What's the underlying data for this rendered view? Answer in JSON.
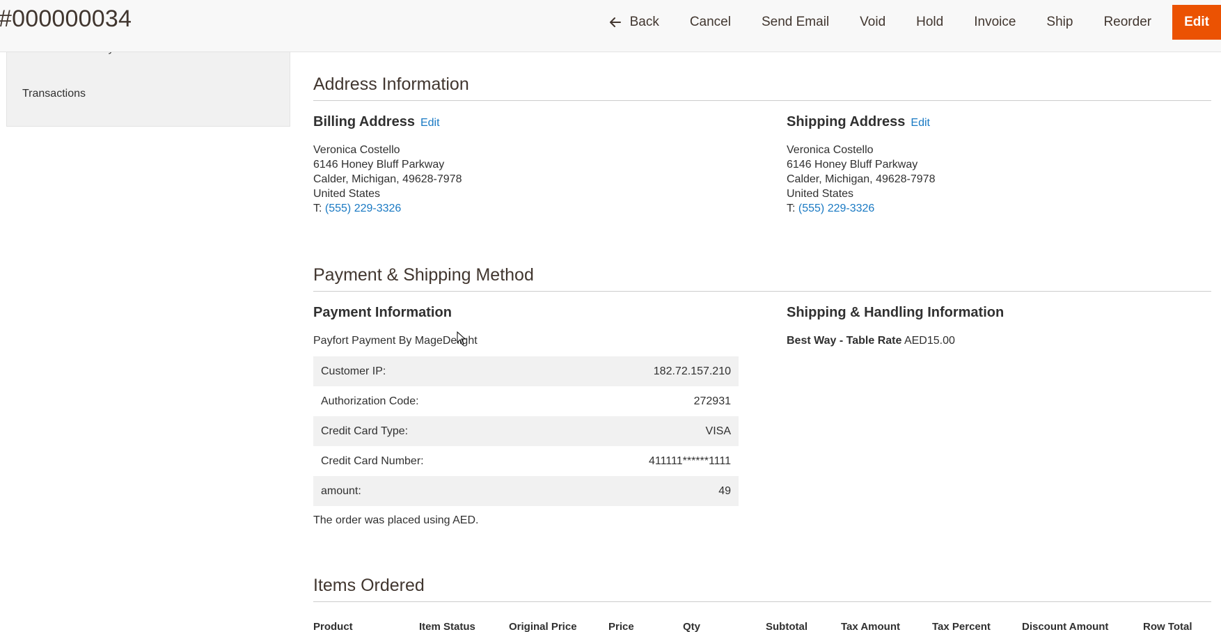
{
  "header": {
    "order_title": "#000000034",
    "actions": {
      "back": "Back",
      "cancel": "Cancel",
      "send_email": "Send Email",
      "void": "Void",
      "hold": "Hold",
      "invoice": "Invoice",
      "ship": "Ship",
      "reorder": "Reorder",
      "edit": "Edit"
    },
    "back_icon": "arrow-left-icon"
  },
  "sidebar": {
    "items": [
      "Comments History",
      "Transactions"
    ]
  },
  "address_information": {
    "title": "Address Information",
    "billing": {
      "heading": "Billing Address",
      "edit": "Edit",
      "name": "Veronica Costello",
      "street": "6146 Honey Bluff Parkway",
      "city_line": "Calder, Michigan, 49628-7978",
      "country": "United States",
      "phone_prefix": "T: ",
      "phone": "(555) 229-3326"
    },
    "shipping": {
      "heading": "Shipping Address",
      "edit": "Edit",
      "name": "Veronica Costello",
      "street": "6146 Honey Bluff Parkway",
      "city_line": "Calder, Michigan, 49628-7978",
      "country": "United States",
      "phone_prefix": "T: ",
      "phone": "(555) 229-3326"
    }
  },
  "payment_shipping": {
    "title": "Payment & Shipping Method",
    "payment": {
      "heading": "Payment Information",
      "method": "Payfort Payment By MageDelight",
      "rows": [
        {
          "label": "Customer IP:",
          "value": "182.72.157.210"
        },
        {
          "label": "Authorization Code:",
          "value": "272931"
        },
        {
          "label": "Credit Card Type:",
          "value": "VISA"
        },
        {
          "label": "Credit Card Number:",
          "value": "411111******1111"
        },
        {
          "label": "amount:",
          "value": "49"
        }
      ],
      "currency_note": "The order was placed using AED."
    },
    "shipping": {
      "heading": "Shipping & Handling Information",
      "method": "Best Way - Table Rate",
      "price": "AED15.00"
    }
  },
  "items_ordered": {
    "title": "Items Ordered",
    "columns": [
      "Product",
      "Item Status",
      "Original Price",
      "Price",
      "Qty",
      "Subtotal",
      "Tax Amount",
      "Tax Percent",
      "Discount Amount",
      "Row Total"
    ]
  },
  "colors": {
    "accent": "#eb5202",
    "link": "#1979c3",
    "text": "#303030",
    "header_bg": "#f8f8f8",
    "row_bg": "#f1f1f1"
  }
}
